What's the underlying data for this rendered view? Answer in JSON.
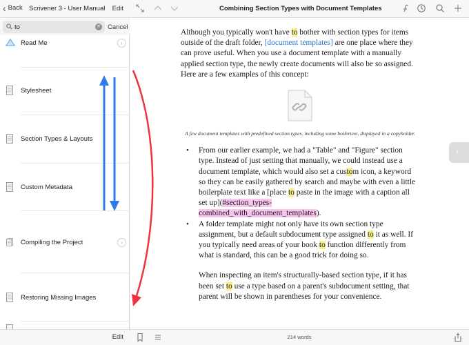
{
  "sidebar": {
    "back_label": "Back",
    "title": "Scrivener 3 - User Manual",
    "edit_top": "Edit",
    "search": {
      "value": "to",
      "placeholder": "Search"
    },
    "cancel_label": "Cancel",
    "items": [
      {
        "label": "Read Me",
        "icon": "folder-icon"
      },
      {
        "label": "Stylesheet",
        "icon": "document-icon"
      },
      {
        "label": "Section Types & Layouts",
        "icon": "document-icon"
      },
      {
        "label": "Custom Metadata",
        "icon": "document-icon"
      },
      {
        "label": "Compiling the Project",
        "icon": "document-icon"
      },
      {
        "label": "Restoring Missing Images",
        "icon": "document-icon"
      }
    ],
    "edit_bottom": "Edit"
  },
  "main": {
    "title": "Combining Section Types with Document Templates",
    "para1": {
      "a": "Although you typically won't have ",
      "hl1": "to",
      "b": " bother with section types for items outside of the draft folder, ",
      "link": "[document templates]",
      "c": " are one place where they can prove useful. When you use a document template with a manually applied section type, the newly create documents will also be so assigned. Here are a few examples of this concept:"
    },
    "caption": "A few document templates with predefined section types, including some boilertext, displayed in a copyholder.",
    "bullet1": {
      "a": "From our earlier example, we had a \"Table\" and \"Figure\" section type. Instead of just setting that manually, we could instead use a document template, which would also set a cus",
      "hl1": "to",
      "b": "m icon, a keyword so they can be easily gathered by search and maybe with even a little boilerplate text like a [place ",
      "hl2": "to",
      "c": " paste in the image with a caption all set up](",
      "pink1": "#section_types-",
      "pink2": "combined_with_document_templates",
      "d": ")."
    },
    "bullet2": {
      "a": "A folder template might not only have its own section type assignment, but a default subdocument type assigned ",
      "hl1": "to",
      "b": " it as well. If you typically need areas of your book ",
      "hl2": "to",
      "c": " function differently from what is standard, this can be a good trick for doing so."
    },
    "para_last": {
      "a": "When inspecting an item's structurally-based section type, if it has been set ",
      "hl1": "to",
      "b": " use a type based on a parent's subdocument setting, that parent will be shown in parentheses for your convenience."
    },
    "word_count": "214 words"
  },
  "colors": {
    "highlight": "#f5f08a",
    "link": "#2a72c9",
    "pink_highlight": "#f7c4ee",
    "annotation_blue": "#2f7be8",
    "annotation_red": "#ee3340"
  }
}
